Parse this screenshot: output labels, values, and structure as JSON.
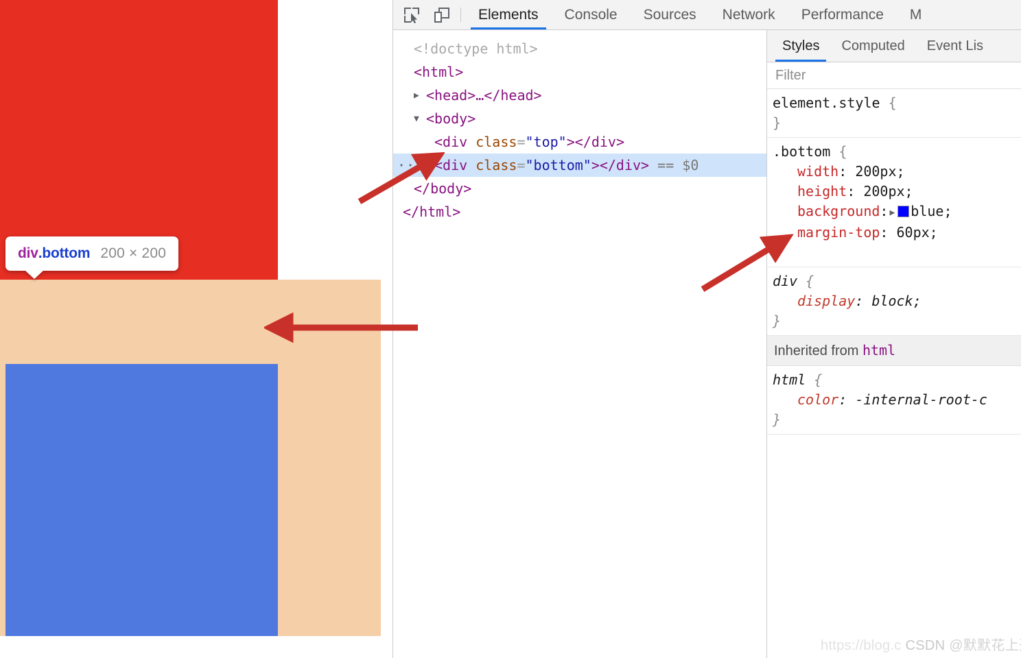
{
  "viewport": {
    "inspect_tooltip": {
      "tag": "div",
      "class_name": ".bottom",
      "dimensions": "200 × 200"
    },
    "boxes": {
      "top_color": "#e62e23",
      "bottom_color": "#5079e0",
      "margin_color": "#f5cfa8"
    }
  },
  "devtools": {
    "toolbar": {
      "icons": [
        {
          "name": "inspect-element-icon"
        },
        {
          "name": "device-toolbar-icon"
        }
      ],
      "tabs": [
        {
          "label": "Elements",
          "active": true
        },
        {
          "label": "Console",
          "active": false
        },
        {
          "label": "Sources",
          "active": false
        },
        {
          "label": "Network",
          "active": false
        },
        {
          "label": "Performance",
          "active": false
        },
        {
          "label": "M",
          "active": false
        }
      ]
    },
    "dom_tree": [
      {
        "id": "doctype",
        "text": "<!doctype html>"
      },
      {
        "id": "html_open",
        "text": "<html>"
      },
      {
        "id": "head",
        "text": "<head>…</head>"
      },
      {
        "id": "body_open",
        "text": "<body>"
      },
      {
        "id": "div_top",
        "tag_open": "<div",
        "attr": "class",
        "value": "\"top\"",
        "tag_close": "></div>"
      },
      {
        "id": "div_bottom",
        "tag_open": "<div",
        "attr": "class",
        "value": "\"bottom\"",
        "tag_close": "></div>",
        "marker": "== $0",
        "selected": true,
        "dots": "···"
      },
      {
        "id": "body_close",
        "text": "</body>"
      },
      {
        "id": "html_close",
        "text": "</html>"
      }
    ],
    "styles": {
      "tabs": [
        {
          "label": "Styles",
          "active": true
        },
        {
          "label": "Computed",
          "active": false
        },
        {
          "label": "Event Lis",
          "active": false
        }
      ],
      "filter_placeholder": "Filter",
      "filter_value": "",
      "rules": [
        {
          "selector": "element.style",
          "declarations": []
        },
        {
          "selector": ".bottom",
          "declarations": [
            {
              "property": "width",
              "value": "200px;"
            },
            {
              "property": "height",
              "value": "200px;"
            },
            {
              "property": "background",
              "value": "blue;",
              "swatch": "#0000ff",
              "has_expander": true
            },
            {
              "property": "margin-top",
              "value": "60px;"
            }
          ]
        },
        {
          "selector": "div",
          "user_agent": true,
          "declarations": [
            {
              "property": "display",
              "value": "block;"
            }
          ]
        }
      ],
      "inherited_label": "Inherited from",
      "inherited_from": "html",
      "inherited_rules": [
        {
          "selector": "html",
          "user_agent": true,
          "declarations": [
            {
              "property": "color",
              "value": "-internal-root-c"
            }
          ]
        }
      ]
    }
  },
  "annotations": {
    "arrow_color": "#c8302a",
    "arrows": [
      {
        "name": "arrow-to-dom-node",
        "points_to": "div.bottom DOM node"
      },
      {
        "name": "arrow-to-margin-top",
        "points_to": "margin-top: 60px declaration"
      },
      {
        "name": "arrow-to-margin-area",
        "points_to": "margin highlight area in page"
      }
    ]
  },
  "watermark": {
    "url": "https://blog.c",
    "brand": "CSDN",
    "author": "@默默花上开"
  }
}
